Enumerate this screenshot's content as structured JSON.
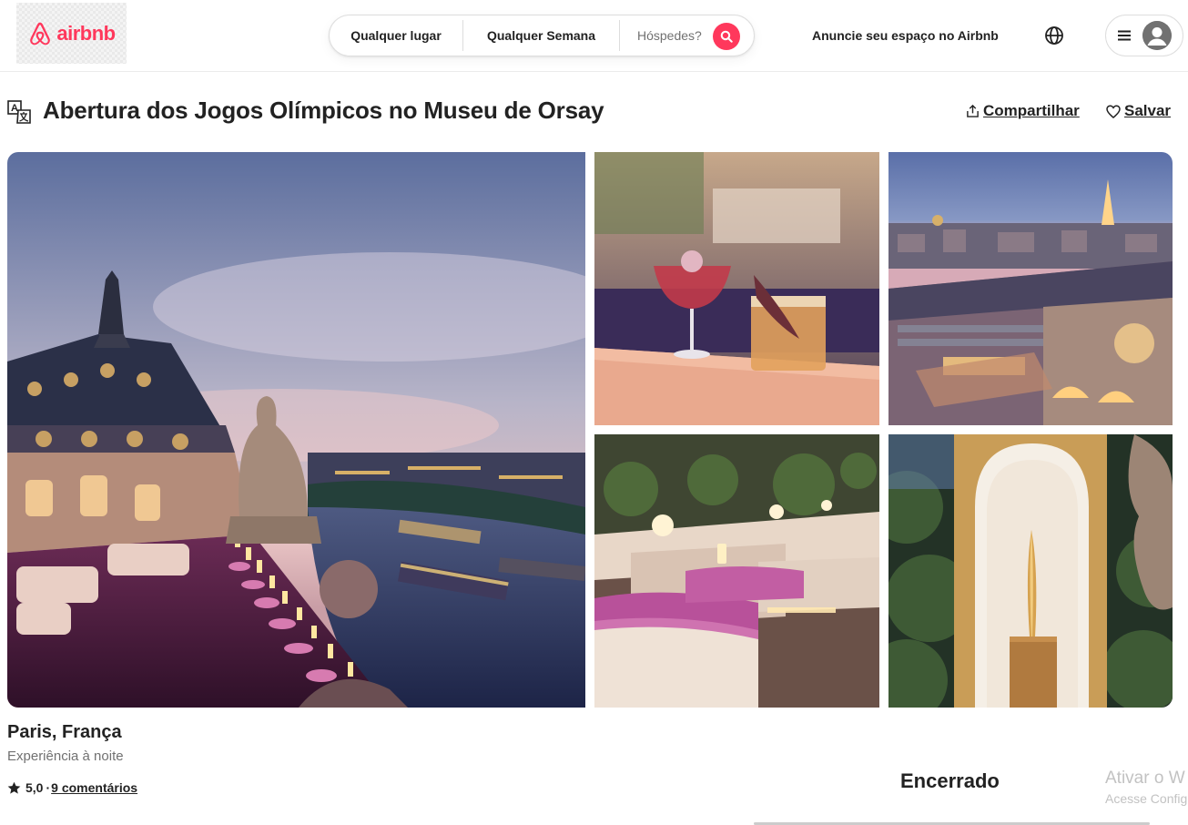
{
  "header": {
    "logo_text": "airbnb",
    "search": {
      "anywhere": "Qualquer lugar",
      "week": "Qualquer Semana",
      "guests_placeholder": "Hóspedes?"
    },
    "host_link": "Anuncie seu espaço no Airbnb",
    "icons": [
      "airbnb-logo-icon",
      "search-icon",
      "globe-icon",
      "menu-icon",
      "avatar-icon"
    ]
  },
  "listing": {
    "title": "Abertura dos Jogos Olímpicos no Museu de Orsay",
    "share_label": "Compartilhar",
    "save_label": "Salvar",
    "location": "Paris, França",
    "subtitle": "Experiência à noite",
    "rating": "5,0",
    "rating_separator": "·",
    "reviews": "9 comentários",
    "status": "Encerrado"
  },
  "gallery": {
    "photos": [
      "rooftop-terrace-river-view",
      "cocktails-on-bar",
      "aerial-museum-orsay",
      "lounge-seating",
      "olympic-torch-display"
    ]
  },
  "watermark": {
    "line1": "Ativar o W",
    "line2": "Acesse Config"
  },
  "colors": {
    "brand": "#ff385c",
    "text": "#222222",
    "muted": "#717171"
  }
}
